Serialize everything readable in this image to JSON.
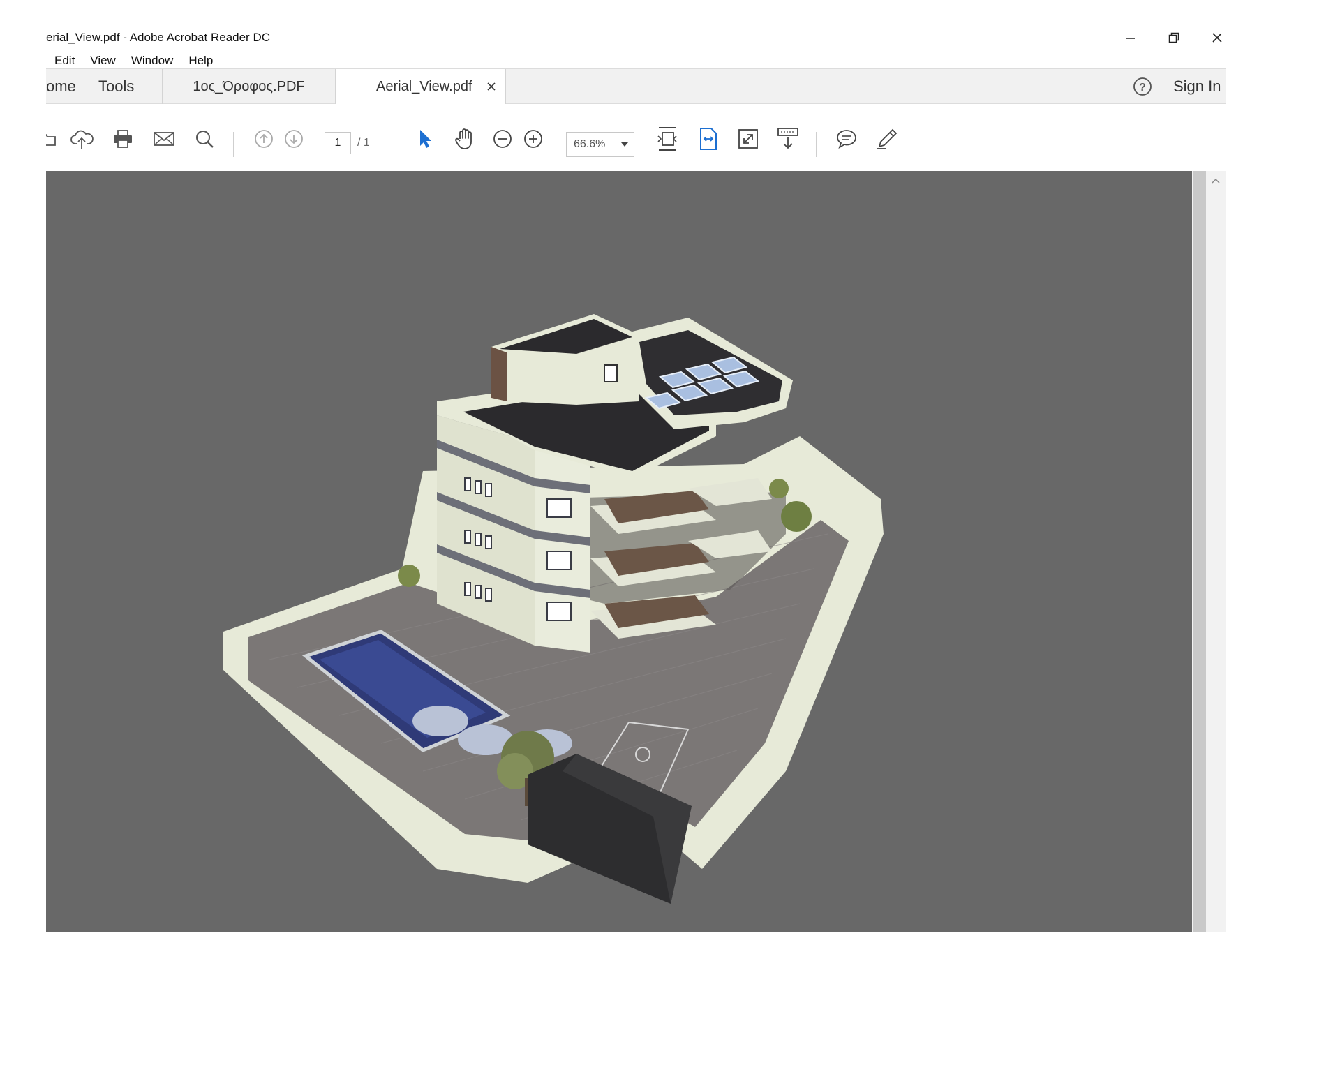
{
  "window": {
    "title": "erial_View.pdf - Adobe Acrobat Reader DC"
  },
  "menu": [
    "Edit",
    "View",
    "Window",
    "Help"
  ],
  "tabs": {
    "home": "ome",
    "tools": "Tools",
    "doc1": "1ος_Όροφος.PDF",
    "doc2": "Aerial_View.pdf",
    "sign_in": "Sign In"
  },
  "toolbar": {
    "page_current": "1",
    "page_total": "/ 1",
    "zoom": "66.6%"
  },
  "icons": {
    "open": "folder-icon",
    "upload": "cloud-upload-icon",
    "print": "print-icon",
    "email": "email-icon",
    "find": "search-icon",
    "prev_page": "arrow-up-circle-icon",
    "next_page": "arrow-down-circle-icon",
    "select": "cursor-arrow-icon",
    "hand": "hand-icon",
    "zoom_out": "zoom-out-icon",
    "zoom_in": "zoom-in-icon",
    "fit_page": "fit-page-icon",
    "fit_width": "fit-width-icon",
    "full_screen": "full-screen-icon",
    "read_mode": "read-mode-icon",
    "comment": "comment-icon",
    "highlight": "pen-icon",
    "help": "help-icon"
  },
  "document": {
    "image": "3D aerial rendering of a multi-storey residential building with roof solar panels, balconies, swimming pool with umbrellas and loungers, paved courtyard with basketball court markings"
  }
}
